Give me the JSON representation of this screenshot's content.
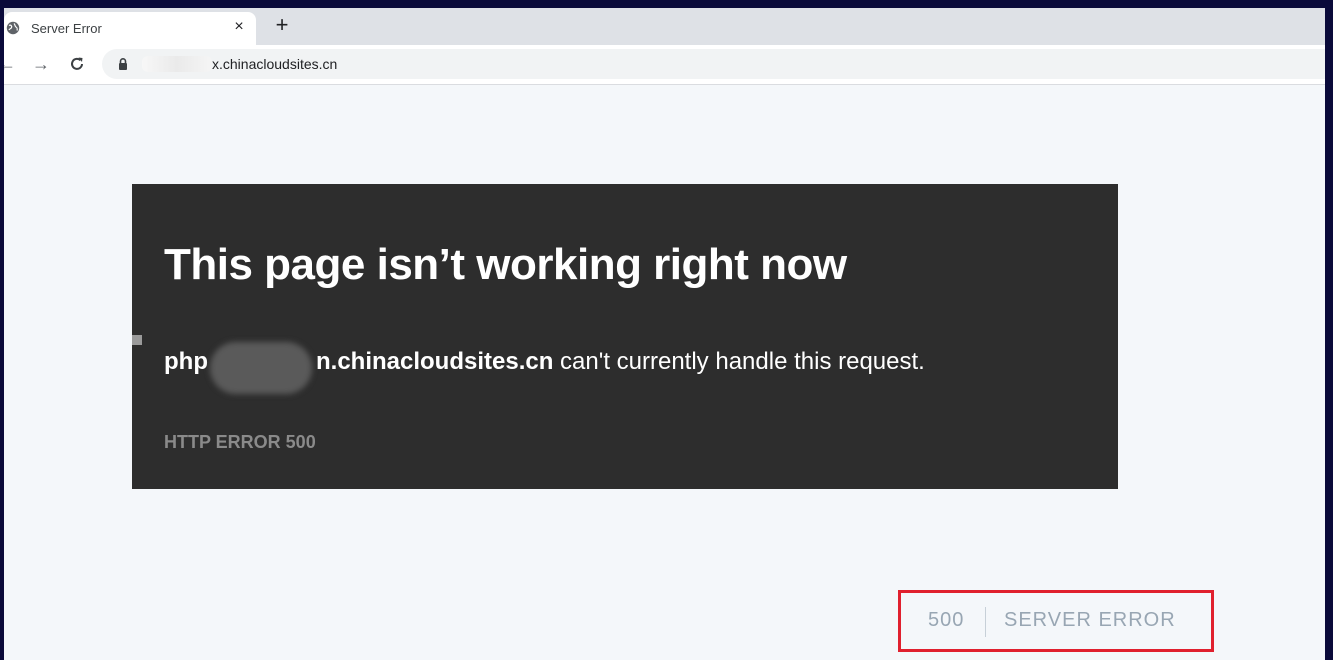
{
  "browser": {
    "tab": {
      "title": "Server Error",
      "favicon": "globe-icon",
      "close_label": "×"
    },
    "new_tab_label": "+",
    "nav": {
      "back": "←",
      "forward": "→",
      "reload": "C"
    },
    "address": {
      "lock_icon": "lock-icon",
      "url_visible": "x.chinacloudsites.cn"
    }
  },
  "error_page": {
    "heading": "This page isn’t working right now",
    "host_prefix": "php",
    "host_suffix": "n.chinacloudsites.cn",
    "message_rest": " can't currently handle this request.",
    "error_code": "HTTP ERROR 500"
  },
  "status": {
    "code": "500",
    "text": "SERVER ERROR",
    "highlight_color": "#e0202e"
  }
}
